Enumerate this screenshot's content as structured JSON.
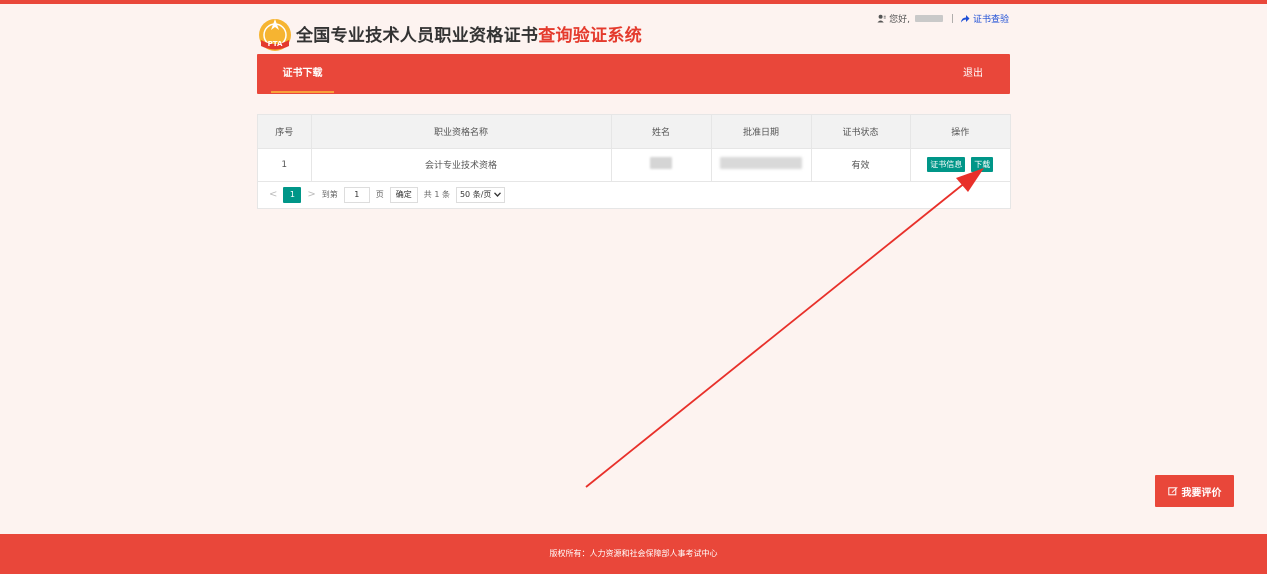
{
  "header": {
    "title_main": "全国专业技术人员职业资格证书",
    "title_accent": "查询验证系统",
    "greeting": "您好,",
    "separator": "|",
    "verify_link": "证书查验",
    "logo_text": "PTA"
  },
  "nav": {
    "tab": "证书下载",
    "logout": "退出"
  },
  "table": {
    "headers": [
      "序号",
      "职业资格名称",
      "姓名",
      "批准日期",
      "证书状态",
      "操作"
    ],
    "rows": [
      {
        "index": "1",
        "qualification": "会计专业技术资格",
        "status": "有效",
        "btn_info": "证书信息",
        "btn_download": "下载"
      }
    ]
  },
  "pager": {
    "prev": "<",
    "current_page": "1",
    "next": ">",
    "goto_label": "到第",
    "goto_value": "1",
    "page_unit": "页",
    "confirm": "确定",
    "total": "共 1 条",
    "page_size": "50 条/页"
  },
  "rate_button": "我要评价",
  "footer": "版权所有：人力资源和社会保障部人事考试中心",
  "colors": {
    "brand_red": "#e9473a",
    "accent_teal": "#009688",
    "tab_underline": "#f7a13a",
    "link_blue": "#1e4fd6",
    "annotation_red": "#e8302a"
  }
}
